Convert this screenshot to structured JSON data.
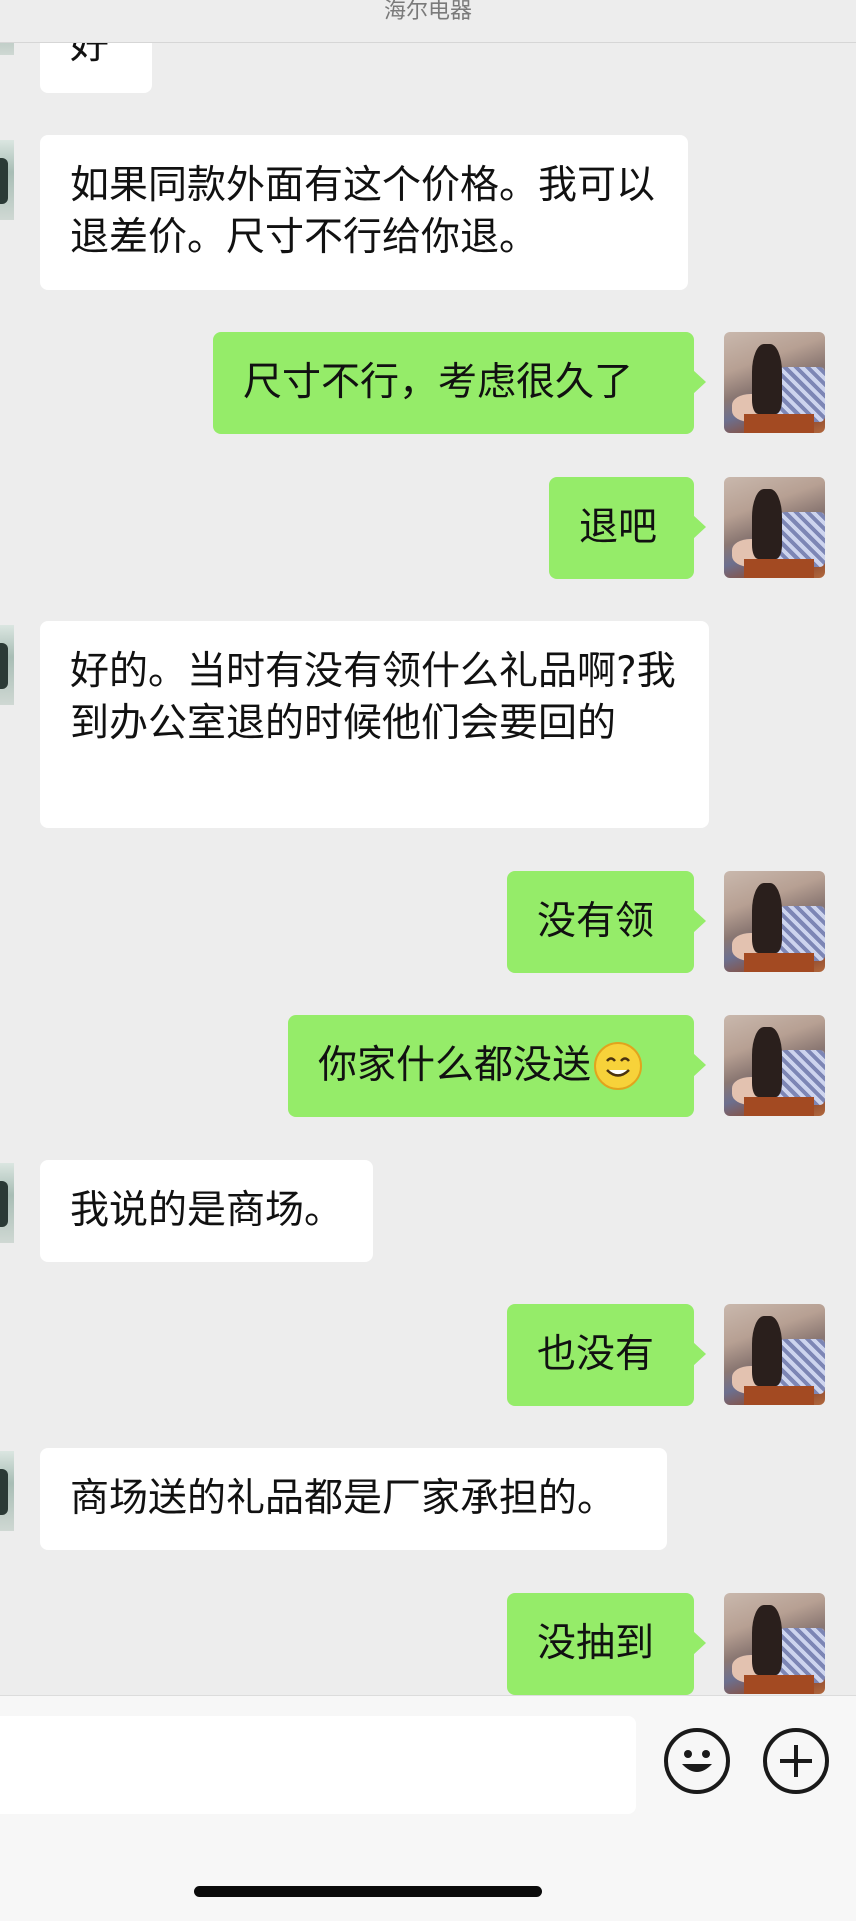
{
  "header": {
    "title": "海尔电器"
  },
  "messages": [
    {
      "side": "in",
      "text": "好"
    },
    {
      "side": "in",
      "text": "如果同款外面有这个价格。我可以退差价。尺寸不行给你退。"
    },
    {
      "side": "out",
      "text": "尺寸不行，考虑很久了"
    },
    {
      "side": "out",
      "text": "退吧"
    },
    {
      "side": "in",
      "text": "好的。当时有没有领什么礼品啊?我到办公室退的时候他们会要回的"
    },
    {
      "side": "out",
      "text": "没有领"
    },
    {
      "side": "out",
      "text": "你家什么都没送",
      "emoji": "smiling-emoji"
    },
    {
      "side": "in",
      "text": "我说的是商场。"
    },
    {
      "side": "out",
      "text": "也没有"
    },
    {
      "side": "in",
      "text": "商场送的礼品都是厂家承担的。"
    },
    {
      "side": "out",
      "text": "没抽到"
    }
  ],
  "input": {
    "value": "",
    "emoji_icon": "smile-face-icon",
    "plus_icon": "plus-circle-icon"
  },
  "colors": {
    "out_bubble": "#95ec69",
    "in_bubble": "#ffffff",
    "background": "#ededed"
  }
}
